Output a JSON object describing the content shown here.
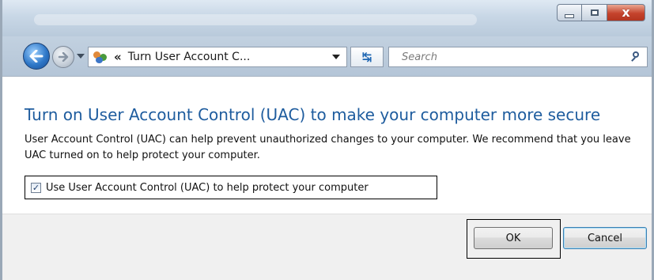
{
  "address_bar": {
    "separator": "«",
    "path_text": "Turn User Account C...",
    "icon": "user-accounts-icon"
  },
  "search": {
    "placeholder": "Search",
    "icon": "search-icon"
  },
  "window_controls": {
    "minimize_icon": "minimize-icon",
    "maximize_icon": "maximize-icon",
    "close_icon": "close-icon",
    "close_glyph": "x"
  },
  "nav": {
    "back_icon": "back-arrow-icon",
    "forward_icon": "forward-arrow-icon",
    "refresh_icon": "refresh-icon",
    "refresh_glyph": "↹"
  },
  "main": {
    "title": "Turn on User Account Control (UAC) to make your computer more secure",
    "description": "User Account Control (UAC) can help prevent unauthorized changes to your computer.  We recommend that you leave UAC turned on to help protect your computer.",
    "checkbox": {
      "label": "Use User Account Control (UAC) to help protect your computer",
      "checked": true,
      "check_glyph": "✓"
    }
  },
  "footer": {
    "ok_label": "OK",
    "cancel_label": "Cancel"
  },
  "colors": {
    "title": "#1e5c9e",
    "close_button": "#c5432c",
    "accent": "#2f78c8"
  }
}
